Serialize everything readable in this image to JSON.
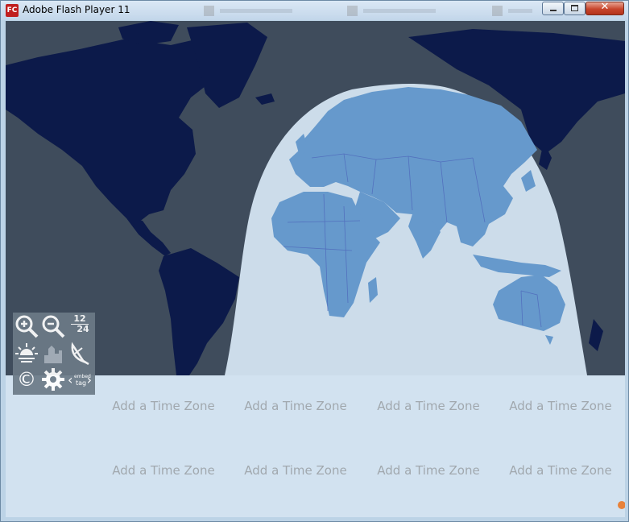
{
  "window": {
    "title": "Adobe Flash Player 11",
    "icon_label": "FC",
    "close_glyph": "✕"
  },
  "toolbox": {
    "time_format_top": "12",
    "time_format_bottom": "24",
    "embed_label_top": "embed",
    "embed_label_bottom": "tag",
    "copyright_glyph": "©"
  },
  "time_zones": [
    {
      "label": "Add a Time Zone"
    },
    {
      "label": "Add a Time Zone"
    },
    {
      "label": "Add a Time Zone"
    },
    {
      "label": "Add a Time Zone"
    },
    {
      "label": "Add a Time Zone"
    },
    {
      "label": "Add a Time Zone"
    },
    {
      "label": "Add a Time Zone"
    },
    {
      "label": "Add a Time Zone"
    }
  ],
  "colors": {
    "night_ocean": "#3f4c5c",
    "night_land": "#0c1a4a",
    "day_ocean": "#d2e2f0",
    "day_land": "#6699cc",
    "zone_text": "#a1a8ae"
  }
}
